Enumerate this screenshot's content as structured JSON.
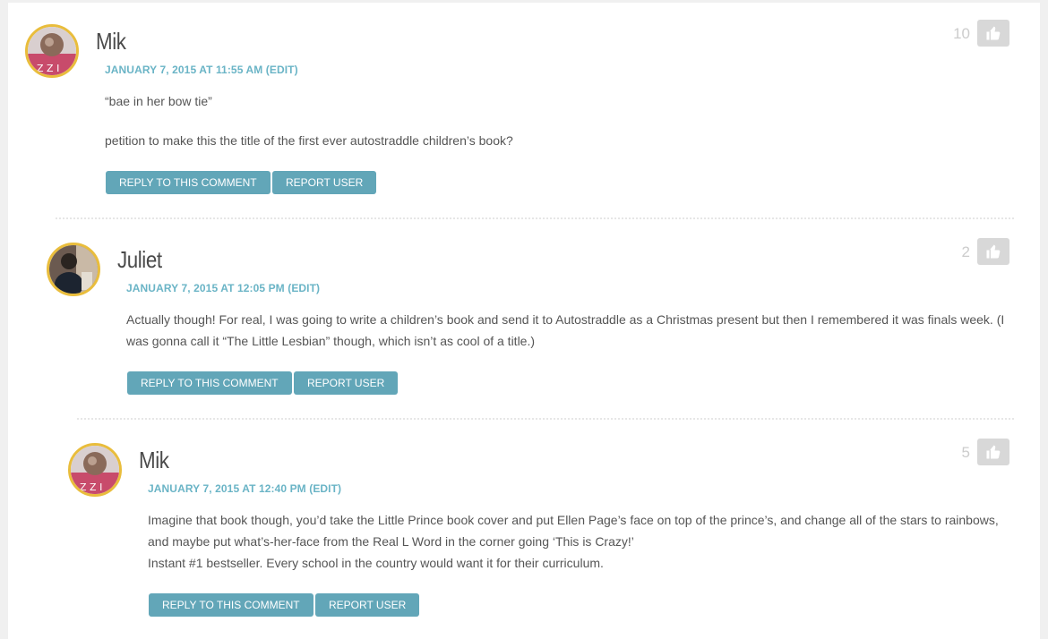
{
  "comments": [
    {
      "author": "Mik",
      "timestamp": "JANUARY 7, 2015 AT 11:55 AM",
      "edit_label": "(EDIT)",
      "paragraphs": [
        "“bae in her bow tie”",
        "petition to make this the title of the first ever autostraddle children’s book?"
      ],
      "likes": "10",
      "reply_label": "REPLY TO THIS COMMENT",
      "report_label": "REPORT USER"
    },
    {
      "author": "Juliet",
      "timestamp": "JANUARY 7, 2015 AT 12:05 PM",
      "edit_label": "(EDIT)",
      "paragraphs": [
        "Actually though! For real, I was going to write a children’s book and send it to Autostraddle as a Christmas present but then I remembered it was finals week. (I was gonna call it “The Little Lesbian” though, which isn’t as cool of a title.)"
      ],
      "likes": "2",
      "reply_label": "REPLY TO THIS COMMENT",
      "report_label": "REPORT USER"
    },
    {
      "author": "Mik",
      "timestamp": "JANUARY 7, 2015 AT 12:40 PM",
      "edit_label": "(EDIT)",
      "paragraphs": [
        "Imagine that book though, you’d take the Little Prince book cover and put Ellen Page’s face on top of the prince’s, and change all of the stars to rainbows, and maybe put what’s-her-face from the Real L Word in the corner going ‘This is Crazy!’",
        "Instant #1 bestseller. Every school in the country would want it for their curriculum."
      ],
      "likes": "5",
      "reply_label": "REPLY TO THIS COMMENT",
      "report_label": "REPORT USER"
    }
  ],
  "colors": {
    "accent": "#62a6b8",
    "meta": "#6ab4c6",
    "avatar_border": "#e9bd3c",
    "like_button": "#d8d8d8"
  },
  "icons": {
    "like": "thumbs-up-icon"
  }
}
